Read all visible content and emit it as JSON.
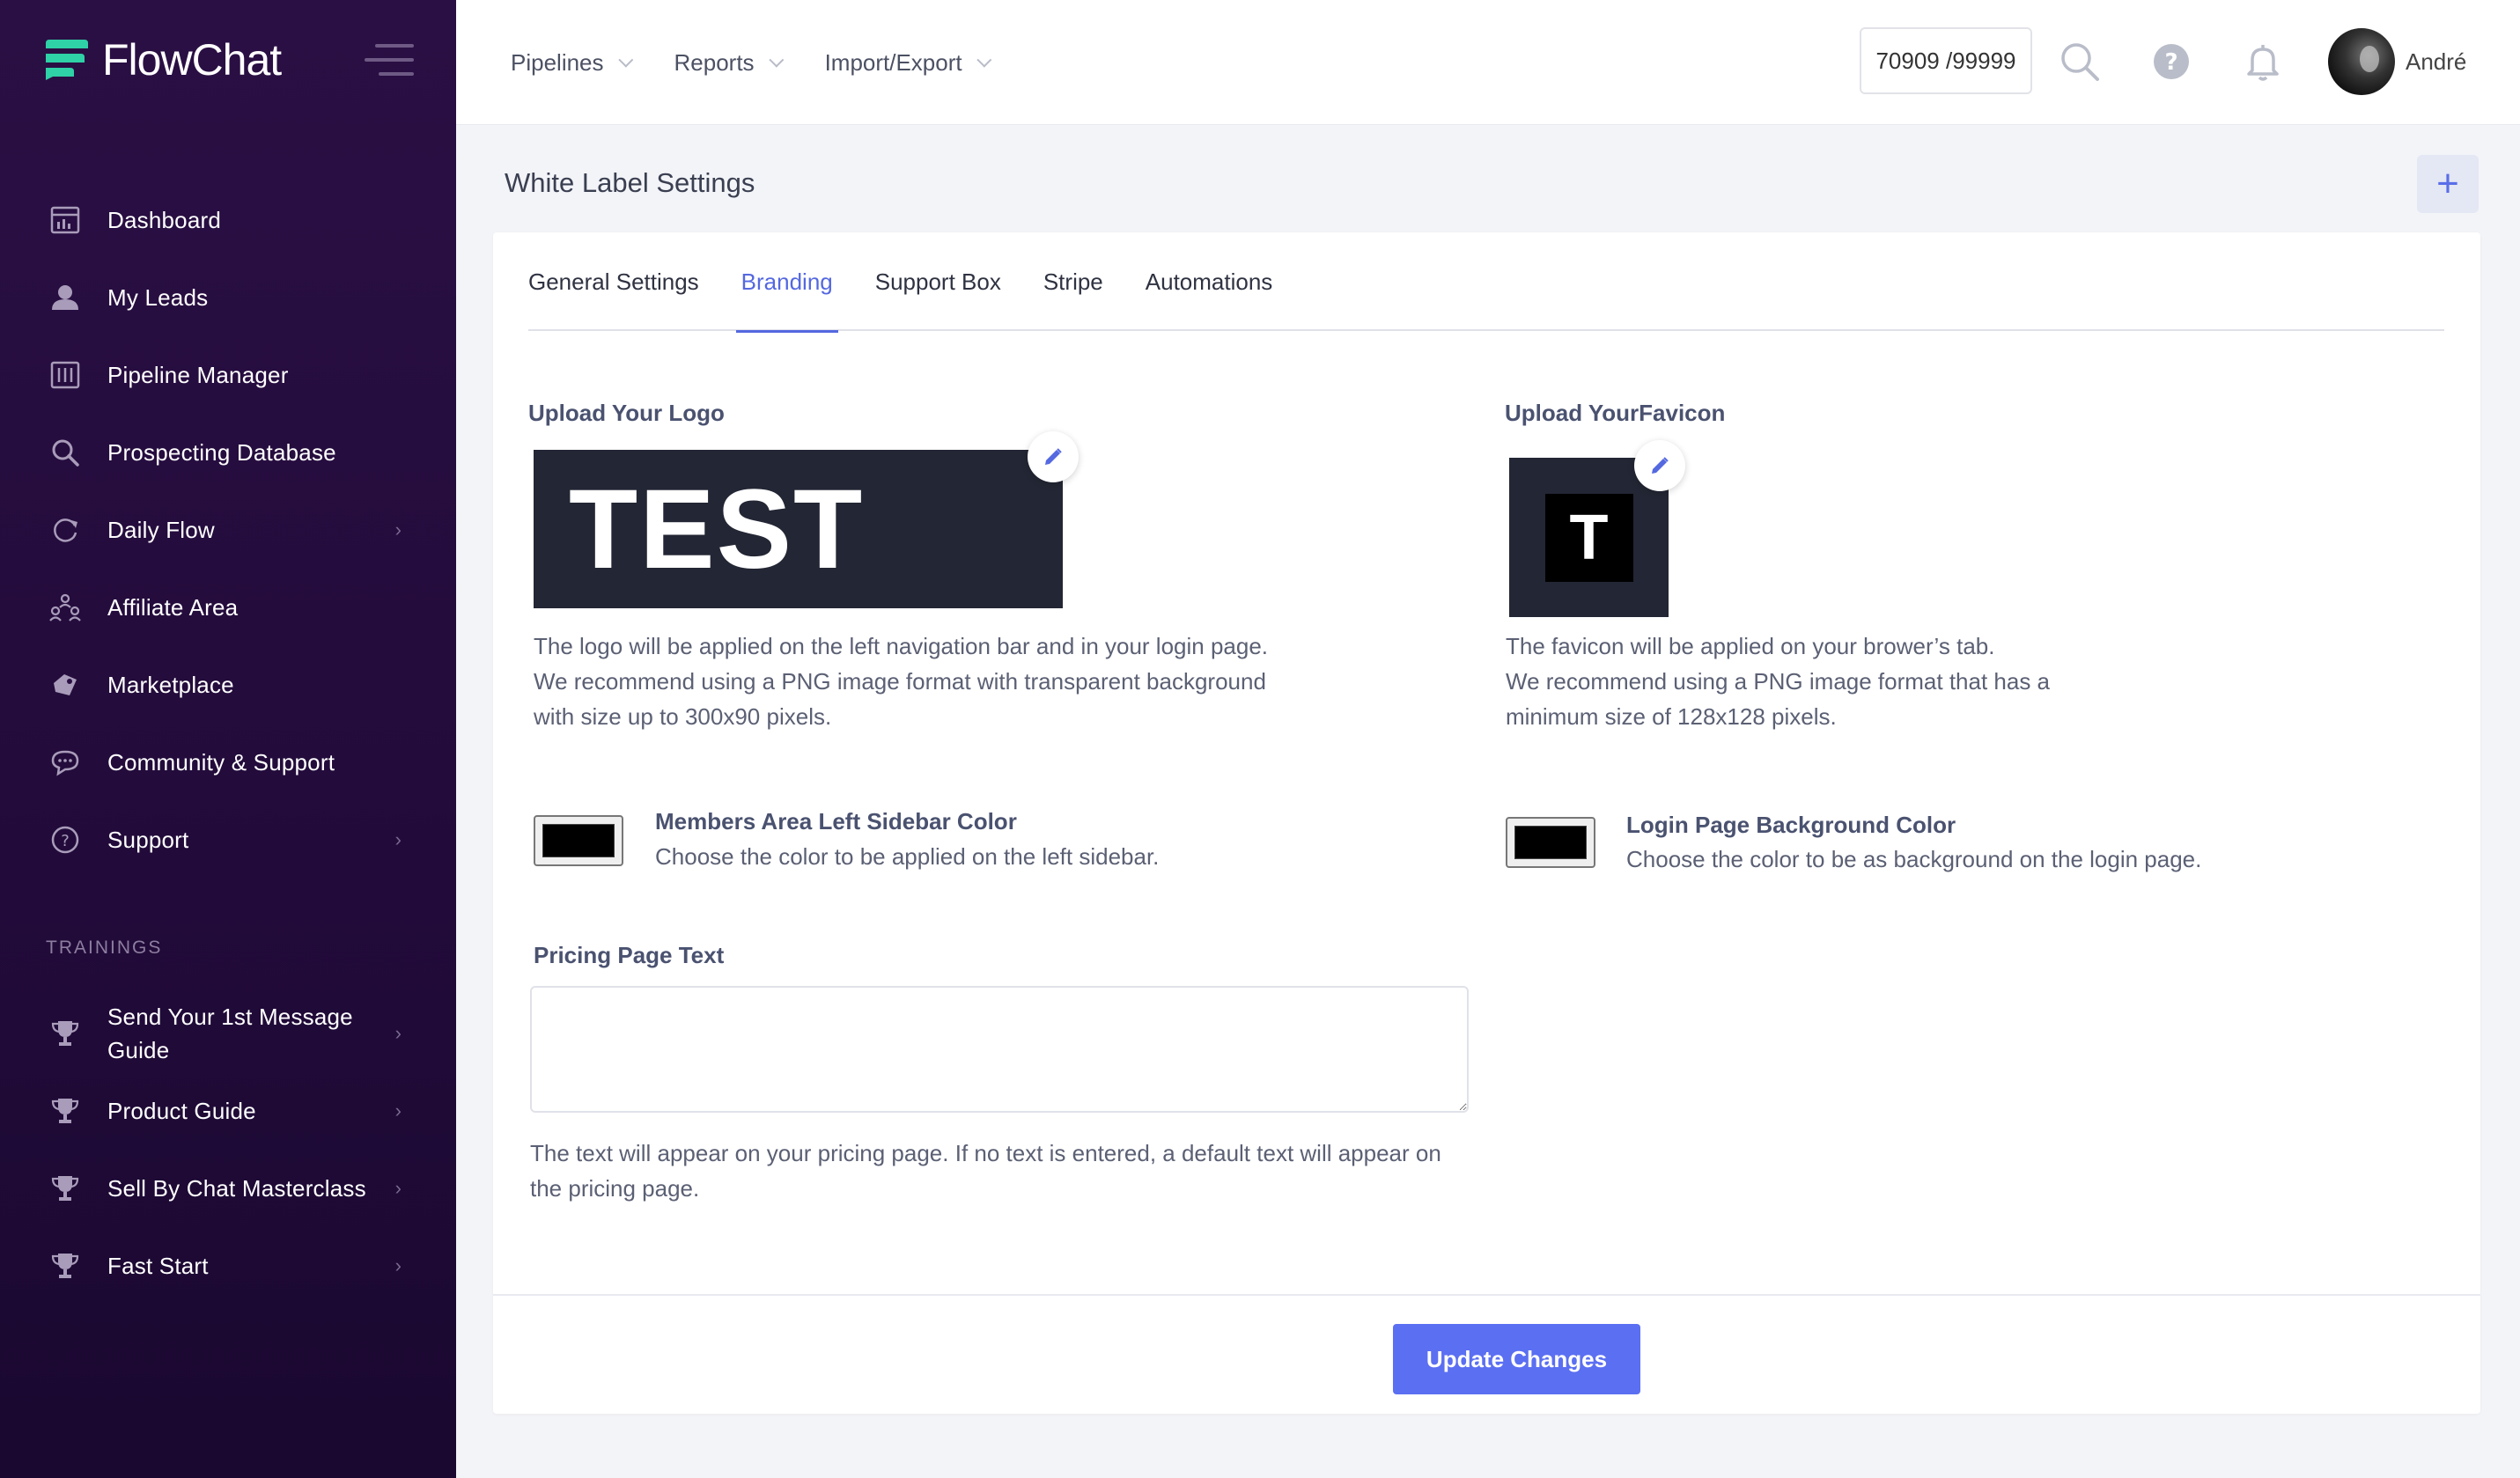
{
  "brand": {
    "name": "FlowChat",
    "accent": "#2fd1a6"
  },
  "sidebar": {
    "items": [
      {
        "label": "Dashboard",
        "icon": "dashboard-icon"
      },
      {
        "label": "My Leads",
        "icon": "user-icon"
      },
      {
        "label": "Pipeline Manager",
        "icon": "pipeline-icon"
      },
      {
        "label": "Prospecting Database",
        "icon": "search-icon"
      },
      {
        "label": "Daily Flow",
        "icon": "refresh-icon"
      },
      {
        "label": "Affiliate Area",
        "icon": "affiliate-icon"
      },
      {
        "label": "Marketplace",
        "icon": "marketplace-icon"
      },
      {
        "label": "Community & Support",
        "icon": "chat-icon"
      },
      {
        "label": "Support",
        "icon": "help-icon"
      }
    ],
    "trainings_title": "TRAININGS",
    "trainings": [
      {
        "label_line1": "Send Your 1st Message",
        "label_line2": "Guide"
      },
      {
        "label": "Product Guide"
      },
      {
        "label": "Sell By Chat Masterclass"
      },
      {
        "label": "Fast Start"
      }
    ]
  },
  "topbar": {
    "menu": [
      "Pipelines",
      "Reports",
      "Import/Export"
    ],
    "credits": "70909 /99999",
    "user_name": "André"
  },
  "page": {
    "title": "White Label Settings",
    "plus": "+"
  },
  "tabs": [
    "General Settings",
    "Branding",
    "Support Box",
    "Stripe",
    "Automations"
  ],
  "active_tab": "Branding",
  "branding": {
    "logo_label": "Upload Your Logo",
    "logo_text": "TEST",
    "logo_help": [
      "The logo will be applied on the left navigation bar and in your login page.",
      "We recommend using a PNG image format with transparent background",
      "with size up to 300x90 pixels."
    ],
    "favicon_label": "Upload YourFavicon",
    "favicon_text": "T",
    "favicon_help": [
      "The favicon will be applied on your brower’s tab.",
      "We recommend using a PNG image format that has a",
      "minimum size of 128x128 pixels."
    ],
    "sidebar_color_label": "Members Area Left Sidebar Color",
    "sidebar_color_help": "Choose the color to be applied on the left sidebar.",
    "sidebar_color": "#000000",
    "login_color_label": "Login Page Background Color",
    "login_color_help": "Choose the color to be as background on the login page.",
    "login_color": "#000000",
    "pricing_label": "Pricing Page Text",
    "pricing_value": "",
    "pricing_help": [
      "The text will appear on your pricing page. If no text is entered, a default text will appear on",
      "the pricing page."
    ]
  },
  "actions": {
    "update_label": "Update Changes"
  },
  "colors": {
    "primary": "#5b6ff2",
    "sidebar_bg": "#2a0f44"
  }
}
